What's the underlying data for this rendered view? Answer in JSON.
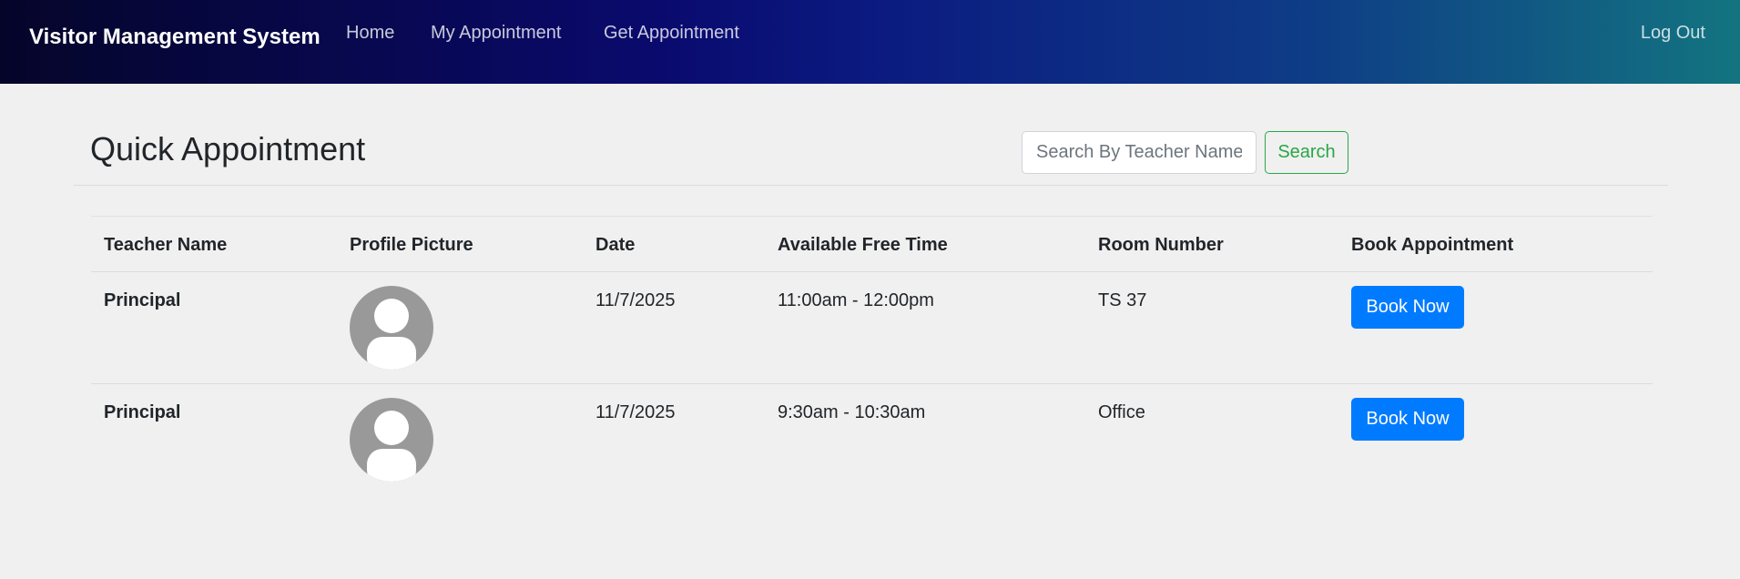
{
  "nav": {
    "brand": "Visitor Management System",
    "links": [
      "Home",
      "My Appointment",
      "Get Appointment"
    ],
    "logout": "Log Out"
  },
  "page": {
    "title": "Quick Appointment",
    "search_placeholder": "Search By Teacher Name",
    "search_button": "Search"
  },
  "table": {
    "headers": [
      "Teacher Name",
      "Profile Picture",
      "Date",
      "Available Free Time",
      "Room Number",
      "Book Appointment"
    ],
    "rows": [
      {
        "teacher": "Principal",
        "avatar_icon": "user-avatar-icon",
        "date": "11/7/2025",
        "time": "11:00am - 12:00pm",
        "room": "TS 37",
        "action": "Book Now"
      },
      {
        "teacher": "Principal",
        "avatar_icon": "user-avatar-icon",
        "date": "11/7/2025",
        "time": "9:30am - 10:30am",
        "room": "Office",
        "action": "Book Now"
      }
    ]
  },
  "colors": {
    "primary_button": "#007bff",
    "search_outline": "#28a745",
    "page_background": "#f0f0f0"
  }
}
